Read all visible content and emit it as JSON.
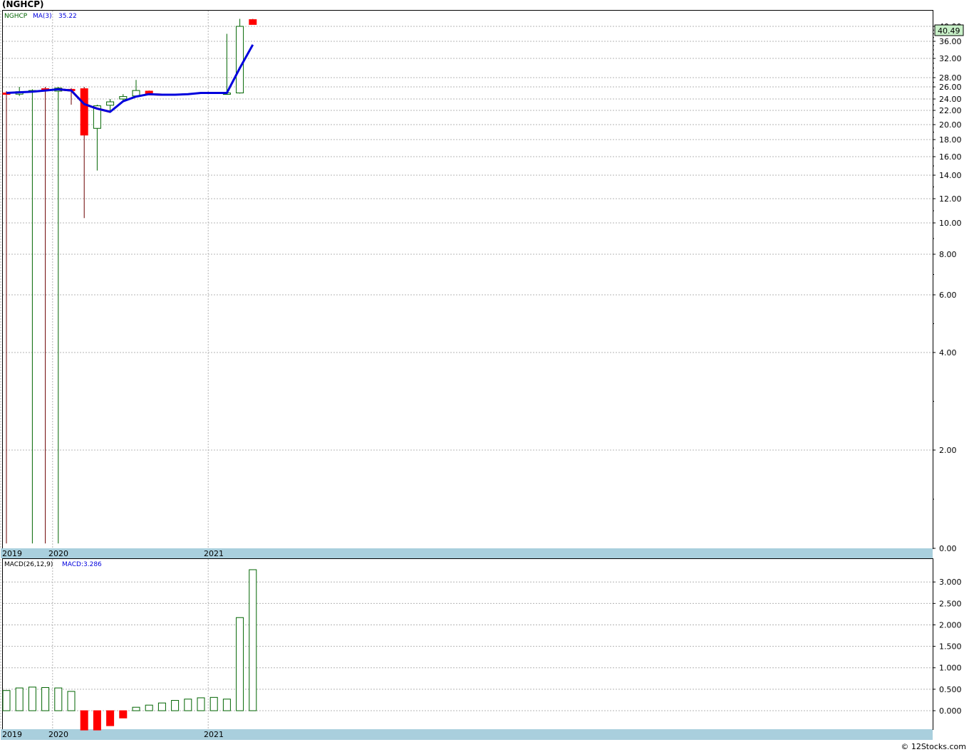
{
  "title": "(NGHCP)",
  "credit": "© 12Stocks.com",
  "colors": {
    "up": "#006400",
    "down": "#ff0000",
    "ma": "#0000dd",
    "band": "#a9cfdd",
    "grid": "#b4b4b4"
  },
  "price_panel": {
    "legend": {
      "symbol": "NGHCP",
      "ma_label": "MA(3)",
      "ma_value": "35.22"
    },
    "last_price_badge": "40.49",
    "y_ticks": [
      "40.00",
      "36.00",
      "32.00",
      "28.00",
      "26.00",
      "24.00",
      "22.00",
      "20.00",
      "18.00",
      "16.00",
      "14.00",
      "12.00",
      "10.00",
      "8.00",
      "6.00",
      "4.00",
      "2.00",
      "0.00"
    ],
    "x_labels": [
      "2019",
      "2020",
      "2021"
    ]
  },
  "macd_panel": {
    "legend": {
      "label": "MACD(26,12,9)",
      "value_label": "MACD:3.286"
    },
    "y_ticks": [
      "3.000",
      "2.500",
      "2.000",
      "1.500",
      "1.000",
      "0.500",
      "0.000"
    ],
    "x_labels": [
      "2019",
      "2020",
      "2021"
    ]
  },
  "chart_data": [
    {
      "type": "candlestick",
      "title": "(NGHCP)",
      "y_scale": "log",
      "ylim": [
        0,
        40
      ],
      "x_axis_labels": [
        "2019",
        "2020",
        "2021"
      ],
      "series": [
        {
          "name": "NGHCP",
          "ohlc": [
            [
              0,
              25.0,
              25.3,
              0.1,
              24.9
            ],
            [
              1,
              24.8,
              26.0,
              24.5,
              25.2
            ],
            [
              2,
              25.2,
              25.6,
              0.1,
              25.4
            ],
            [
              3,
              25.7,
              26.0,
              0.1,
              25.5
            ],
            [
              4,
              25.3,
              26.0,
              0.1,
              25.8
            ],
            [
              5,
              25.6,
              25.8,
              23.0,
              25.4
            ],
            [
              6,
              25.7,
              26.0,
              10.4,
              18.6
            ],
            [
              7,
              19.5,
              23.0,
              14.5,
              22.8
            ],
            [
              8,
              22.9,
              24.0,
              22.0,
              23.5
            ],
            [
              9,
              24.0,
              24.8,
              23.5,
              24.4
            ],
            [
              10,
              24.5,
              27.5,
              24.3,
              25.4
            ],
            [
              11,
              25.3,
              25.4,
              24.6,
              24.7
            ],
            [
              17,
              25.0,
              38.0,
              25.0,
              25.0
            ],
            [
              18,
              25.0,
              42.0,
              24.9,
              40.0
            ],
            [
              19,
              41.8,
              42.0,
              40.6,
              40.5
            ]
          ]
        },
        {
          "name": "MA(3)",
          "values": [
            [
              0,
              25.0
            ],
            [
              1,
              25.1
            ],
            [
              2,
              25.2
            ],
            [
              3,
              25.4
            ],
            [
              4,
              25.6
            ],
            [
              5,
              25.4
            ],
            [
              6,
              23.1
            ],
            [
              7,
              22.3
            ],
            [
              8,
              21.8
            ],
            [
              9,
              23.6
            ],
            [
              10,
              24.4
            ],
            [
              11,
              24.8
            ],
            [
              12,
              24.7
            ],
            [
              13,
              24.7
            ],
            [
              14,
              24.8
            ],
            [
              15,
              25.0
            ],
            [
              16,
              25.0
            ],
            [
              17,
              25.0
            ],
            [
              18,
              30.0
            ],
            [
              19,
              35.2
            ]
          ]
        }
      ]
    },
    {
      "type": "bar",
      "title": "MACD(26,12,9)",
      "ylim": [
        -0.45,
        3.3
      ],
      "categories": [
        0,
        1,
        2,
        3,
        4,
        5,
        6,
        7,
        8,
        9,
        10,
        11,
        12,
        13,
        14,
        15,
        16,
        17,
        18,
        19
      ],
      "series": [
        {
          "name": "MACD",
          "values": [
            0.47,
            0.53,
            0.55,
            0.54,
            0.53,
            0.45,
            -0.45,
            -0.45,
            -0.35,
            -0.17,
            0.08,
            0.13,
            0.18,
            0.24,
            0.27,
            0.3,
            0.31,
            0.27,
            2.17,
            3.286
          ]
        }
      ]
    }
  ]
}
